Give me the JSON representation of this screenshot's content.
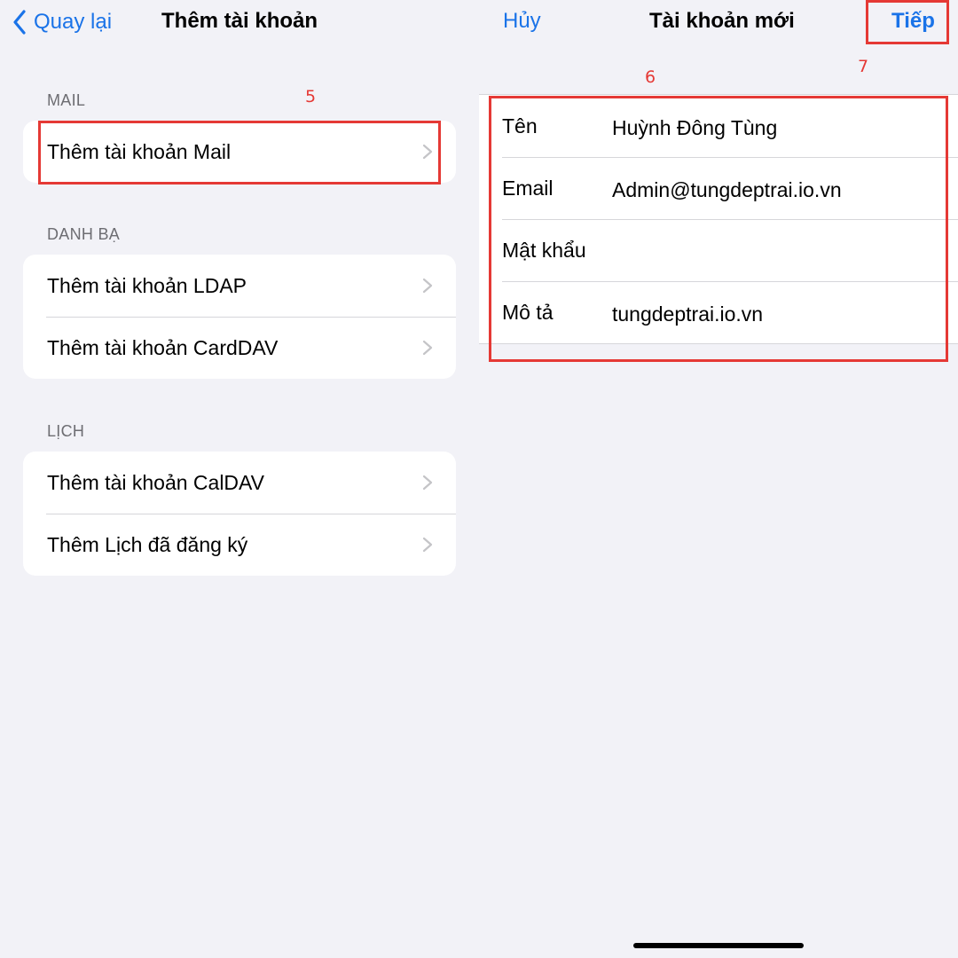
{
  "left_screen": {
    "nav": {
      "back_label": "Quay lại",
      "title": "Thêm tài khoản"
    },
    "sections": [
      {
        "header": "MAIL",
        "items": [
          {
            "label": "Thêm tài khoản Mail"
          }
        ]
      },
      {
        "header": "DANH BẠ",
        "items": [
          {
            "label": "Thêm tài khoản LDAP"
          },
          {
            "label": "Thêm tài khoản CardDAV"
          }
        ]
      },
      {
        "header": "LỊCH",
        "items": [
          {
            "label": "Thêm tài khoản CalDAV"
          },
          {
            "label": "Thêm Lịch đã đăng ký"
          }
        ]
      }
    ]
  },
  "right_screen": {
    "nav": {
      "cancel_label": "Hủy",
      "title": "Tài khoản mới",
      "next_label": "Tiếp"
    },
    "form": {
      "fields": [
        {
          "label": "Tên",
          "value": "Huỳnh Đông Tùng"
        },
        {
          "label": "Email",
          "value": "Admin@tungdeptrai.io.vn"
        },
        {
          "label": "Mật khẩu",
          "value": ""
        },
        {
          "label": "Mô tả",
          "value": "tungdeptrai.io.vn"
        }
      ]
    }
  },
  "annotations": {
    "step_5": "5",
    "step_6": "6",
    "step_7": "7"
  },
  "colors": {
    "accent": "#1a73e8",
    "annotation": "#e53935",
    "background": "#f2f2f7",
    "cell": "#ffffff"
  },
  "icons": {
    "back": "chevron-left-icon",
    "disclosure": "chevron-right-icon"
  }
}
